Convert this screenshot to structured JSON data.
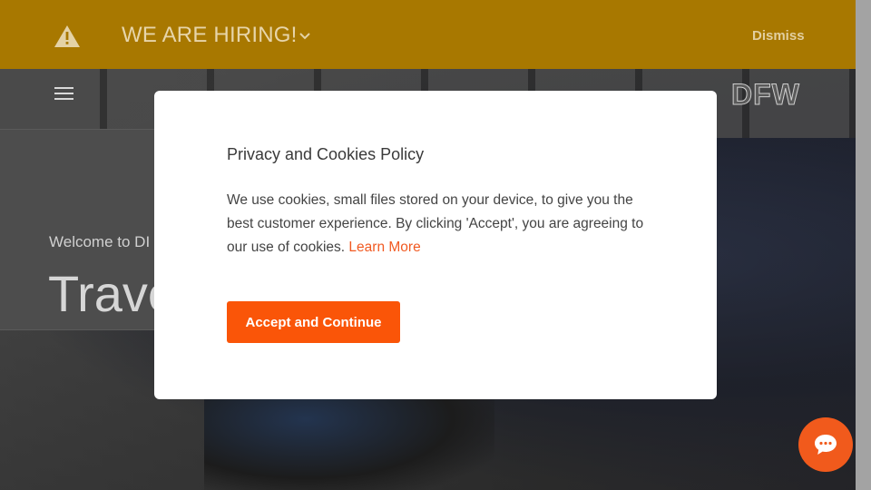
{
  "banner": {
    "title": "WE ARE HIRING!",
    "dismiss_label": "Dismiss",
    "icon": "warning-icon",
    "background_color": "#a87800"
  },
  "header": {
    "menu_icon": "hamburger-menu-icon",
    "logo_text": "DFW"
  },
  "hero": {
    "welcome_text": "Welcome to DI",
    "heading": "Trave"
  },
  "modal": {
    "title": "Privacy and Cookies Policy",
    "body_text": "We use cookies, small files stored on your device, to give you the best customer experience. By clicking 'Accept', you are agreeing to our use of cookies.",
    "learn_more_label": "Learn More",
    "accept_label": "Accept and Continue",
    "accent_color": "#fa5508"
  },
  "chat": {
    "icon": "chat-bubble-icon",
    "color": "#f15a1c"
  }
}
